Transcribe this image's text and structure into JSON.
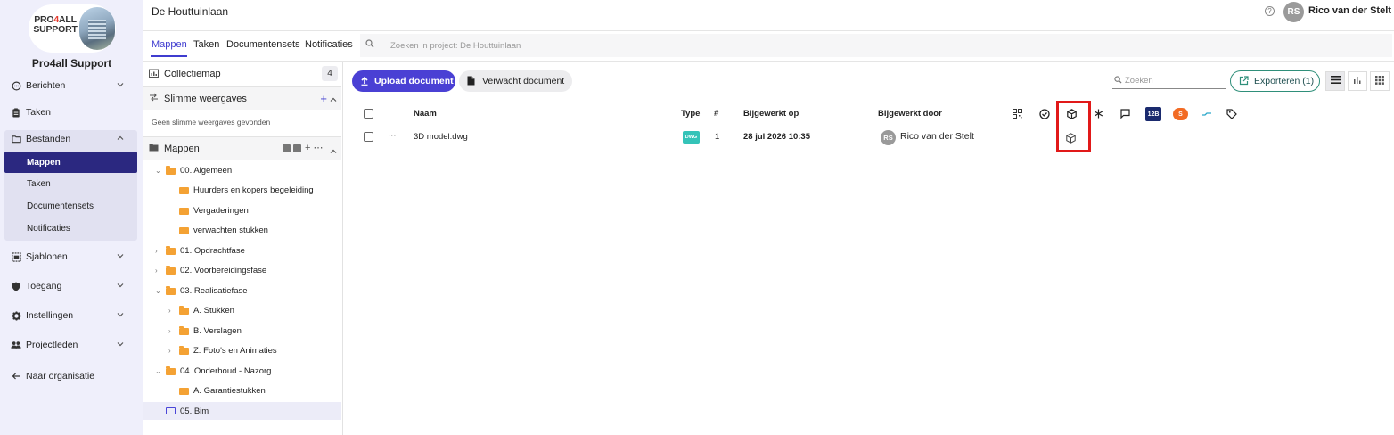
{
  "leftnav": {
    "logo_line1": "PRO",
    "logo_four": "4",
    "logo_line1b": "ALL",
    "logo_line2": "SUPPORT",
    "org_name": "Pro4all Support",
    "items": [
      {
        "label": "Berichten",
        "icon": "chat-icon",
        "expand": "chevron-down"
      },
      {
        "label": "Taken",
        "icon": "clipboard-icon"
      },
      {
        "label": "Bestanden",
        "icon": "folder-icon",
        "expand": "chevron-up"
      },
      {
        "label": "Sjablonen",
        "icon": "template-icon",
        "expand": "chevron-down"
      },
      {
        "label": "Toegang",
        "icon": "shield-icon",
        "expand": "chevron-down"
      },
      {
        "label": "Instellingen",
        "icon": "gear-icon",
        "expand": "chevron-down"
      },
      {
        "label": "Projectleden",
        "icon": "people-icon",
        "expand": "chevron-down"
      },
      {
        "label": "Naar organisatie",
        "icon": "arrow-left-icon"
      }
    ],
    "subitems": [
      "Mappen",
      "Taken",
      "Documentensets",
      "Notificaties"
    ]
  },
  "header": {
    "project_title": "De Houttuinlaan",
    "user_initials": "RS",
    "user_name": "Rico van der Stelt"
  },
  "tabs": [
    "Mappen",
    "Taken",
    "Documentensets",
    "Notificaties"
  ],
  "search": {
    "placeholder": "Zoeken in project: De Houttuinlaan"
  },
  "folderpanel": {
    "collection_label": "Collectiemap",
    "collection_count": "4",
    "smart_label": "Slimme weergaves",
    "smart_add": "+",
    "no_smart": "Geen slimme weergaves gevonden",
    "folders_label": "Mappen",
    "folders_actions": "+ ⋯",
    "tree": [
      {
        "label": "00. Algemeen",
        "level": 0,
        "toggle": "⌄"
      },
      {
        "label": "Huurders en kopers begeleiding",
        "level": 1,
        "toggle": ""
      },
      {
        "label": "Vergaderingen",
        "level": 1,
        "toggle": ""
      },
      {
        "label": "verwachten stukken",
        "level": 1,
        "toggle": ""
      },
      {
        "label": "01. Opdrachtfase",
        "level": 0,
        "toggle": "›"
      },
      {
        "label": "02. Voorbereidingsfase",
        "level": 0,
        "toggle": "›"
      },
      {
        "label": "03. Realisatiefase",
        "level": 0,
        "toggle": "⌄"
      },
      {
        "label": "A. Stukken",
        "level": 1,
        "toggle": "›"
      },
      {
        "label": "B. Verslagen",
        "level": 1,
        "toggle": "›"
      },
      {
        "label": "Z. Foto's en Animaties",
        "level": 1,
        "toggle": "›"
      },
      {
        "label": "04. Onderhoud - Nazorg",
        "level": 0,
        "toggle": "⌄"
      },
      {
        "label": "A. Garantiestukken",
        "level": 1,
        "toggle": ""
      },
      {
        "label": "05. Bim",
        "level": 0,
        "toggle": "",
        "selected": true
      }
    ]
  },
  "toolbar": {
    "upload_label": "Upload document",
    "expected_label": "Verwacht document",
    "search_placeholder": "Zoeken",
    "export_label": "Exporteren (1)"
  },
  "table": {
    "columns": [
      "Naam",
      "Type",
      "#",
      "Bijgewerkt op",
      "Bijgewerkt door"
    ],
    "header_icons": [
      "qr-code-icon",
      "check-circle-icon",
      "cube-icon",
      "snowflake-icon",
      "comment-icon",
      "12build-icon",
      "snag-icon",
      "wave-icon",
      "tag-icon"
    ],
    "header_icon_12b": "12B",
    "header_icon_snag": "S",
    "rows": [
      {
        "name": "3D model.dwg",
        "type_badge": "DWG",
        "version": "1",
        "updated_on": "28 jul 2026 10:35",
        "updated_by_initials": "RS",
        "updated_by": "Rico van der Stelt",
        "more": "⋯"
      }
    ]
  },
  "colors": {
    "accent": "#4a40d4",
    "nav_active": "#2b2880",
    "nav_bg": "#efeffb",
    "highlight_box": "#e11919",
    "folder": "#f4a234",
    "dwg": "#34c3b8"
  }
}
